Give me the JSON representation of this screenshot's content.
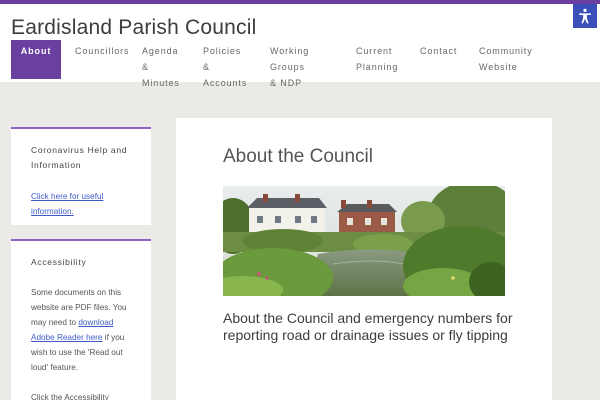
{
  "site": {
    "title": "Eardisland Parish Council"
  },
  "nav": {
    "items": [
      {
        "label_1": "About",
        "label_2": ""
      },
      {
        "label_1": "Councillors",
        "label_2": ""
      },
      {
        "label_1": "Agenda",
        "label_2": "& Minutes"
      },
      {
        "label_1": "Policies",
        "label_2": "& Accounts"
      },
      {
        "label_1": "Working",
        "label_2": "Groups & NDP"
      },
      {
        "label_1": "Current",
        "label_2": "Planning"
      },
      {
        "label_1": "Contact",
        "label_2": ""
      },
      {
        "label_1": "Community",
        "label_2": "Website"
      }
    ],
    "active": "About"
  },
  "sidebar": {
    "corona": {
      "title": "Coronavirus Help and Information",
      "link": "Click here for useful information."
    },
    "accessibility": {
      "title": "Accessibility",
      "text_before": "Some documents on this website are PDF files. You may need to ",
      "link": "download Adobe Reader here",
      "text_after": " if you wish to use the 'Read out loud' feature.",
      "text_2": "Click the Accessibility Menu"
    }
  },
  "main": {
    "title": "About the Council",
    "description": "About the Council and emergency numbers for reporting road or drainage issues or fly tipping"
  },
  "icons": {
    "accessibility": "accessibility-person-icon"
  },
  "colors": {
    "accent": "#6b3fa0",
    "link": "#3e5bc8",
    "accessibility_button": "#3b4fb8"
  }
}
